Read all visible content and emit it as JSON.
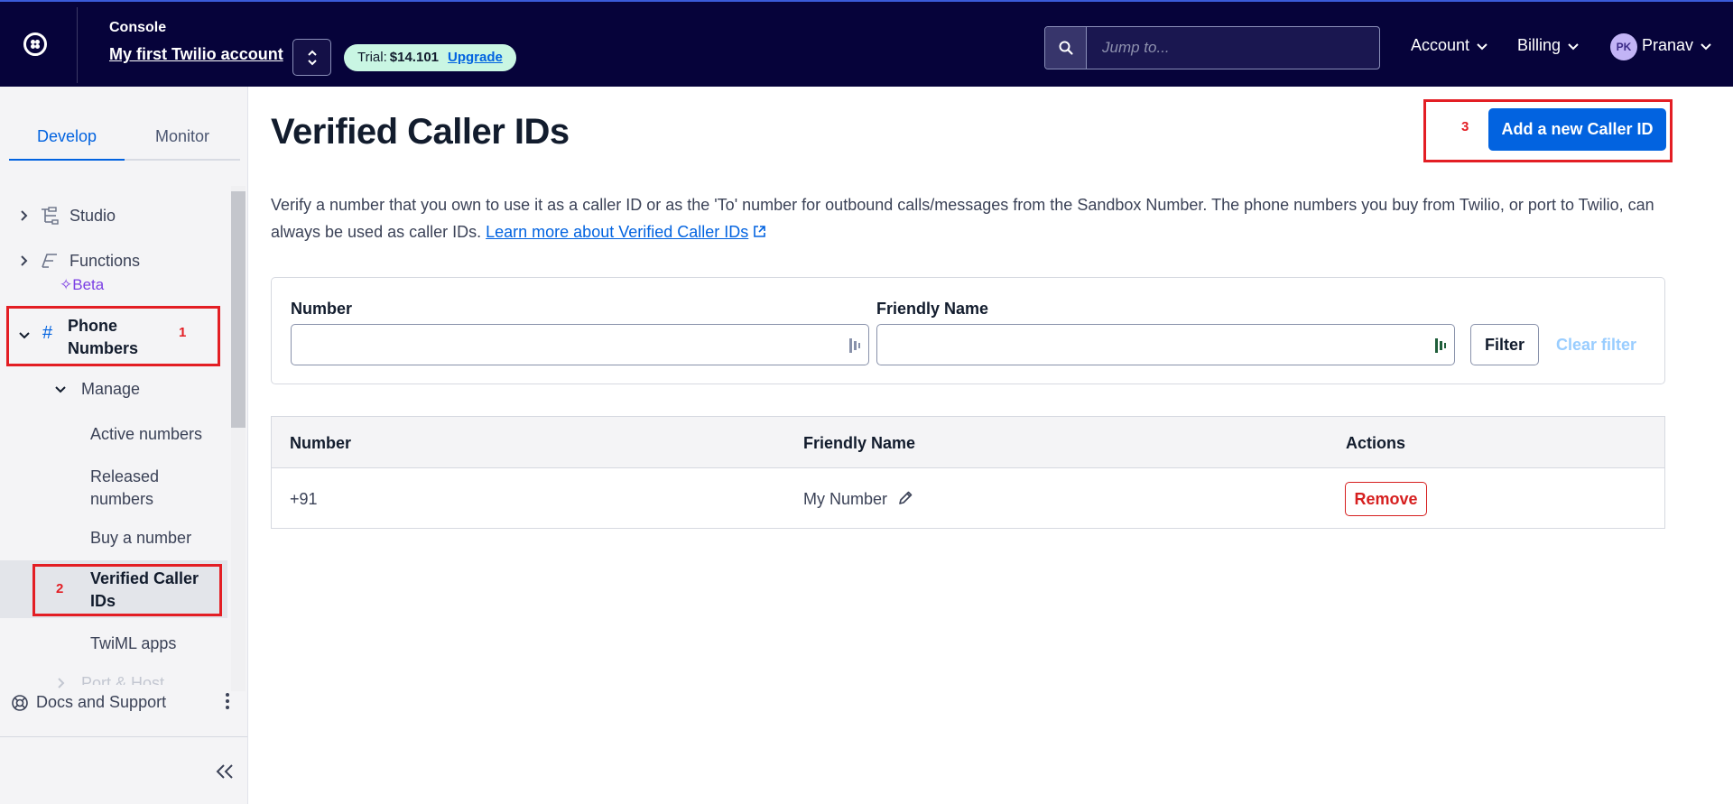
{
  "topbar": {
    "console_label": "Console",
    "account_name": "My first Twilio account",
    "trial_label": "Trial:",
    "trial_amount": "$14.101",
    "upgrade_label": "Upgrade",
    "search_placeholder": "Jump to...",
    "account_menu": "Account",
    "billing_menu": "Billing",
    "user_initials": "PK",
    "user_name": "Pranav"
  },
  "sidebar": {
    "tabs": [
      {
        "label": "Develop",
        "active": true
      },
      {
        "label": "Monitor",
        "active": false
      }
    ],
    "items": {
      "studio": "Studio",
      "functions": "Functions",
      "functions_badge": "Beta",
      "phone_numbers_1": "Phone",
      "phone_numbers_2": "Numbers",
      "manage": "Manage",
      "active_numbers": "Active numbers",
      "released_1": "Released",
      "released_2": "numbers",
      "buy_number": "Buy a number",
      "verified_1": "Verified Caller",
      "verified_2": "IDs",
      "twiml_apps": "TwiML apps",
      "port_host": "Port & Host"
    },
    "docs_support": "Docs and Support"
  },
  "annotations": {
    "step1": "1",
    "step2": "2",
    "step3": "3",
    "highlight_color": "#e31e24"
  },
  "main": {
    "title": "Verified Caller IDs",
    "add_button": "Add a new Caller ID",
    "description": "Verify a number that you own to use it as a caller ID or as the 'To' number for outbound calls/messages from the Sandbox Number. The phone numbers you buy from Twilio, or port to Twilio, can always be used as caller IDs.",
    "learn_more": "Learn more about Verified Caller IDs",
    "filter": {
      "number_label": "Number",
      "number_value": "",
      "friendly_label": "Friendly Name",
      "friendly_value": "",
      "filter_button": "Filter",
      "clear_button": "Clear filter"
    },
    "table": {
      "columns": [
        "Number",
        "Friendly Name",
        "Actions"
      ],
      "rows": [
        {
          "number": "+91",
          "friendly_name": "My Number",
          "action": "Remove"
        }
      ]
    }
  },
  "colors": {
    "topbar_bg": "#06033a",
    "primary": "#0263e0",
    "danger": "#d61f1f",
    "trial_bg": "#c9f6e3",
    "beta": "#7b3fe4"
  }
}
